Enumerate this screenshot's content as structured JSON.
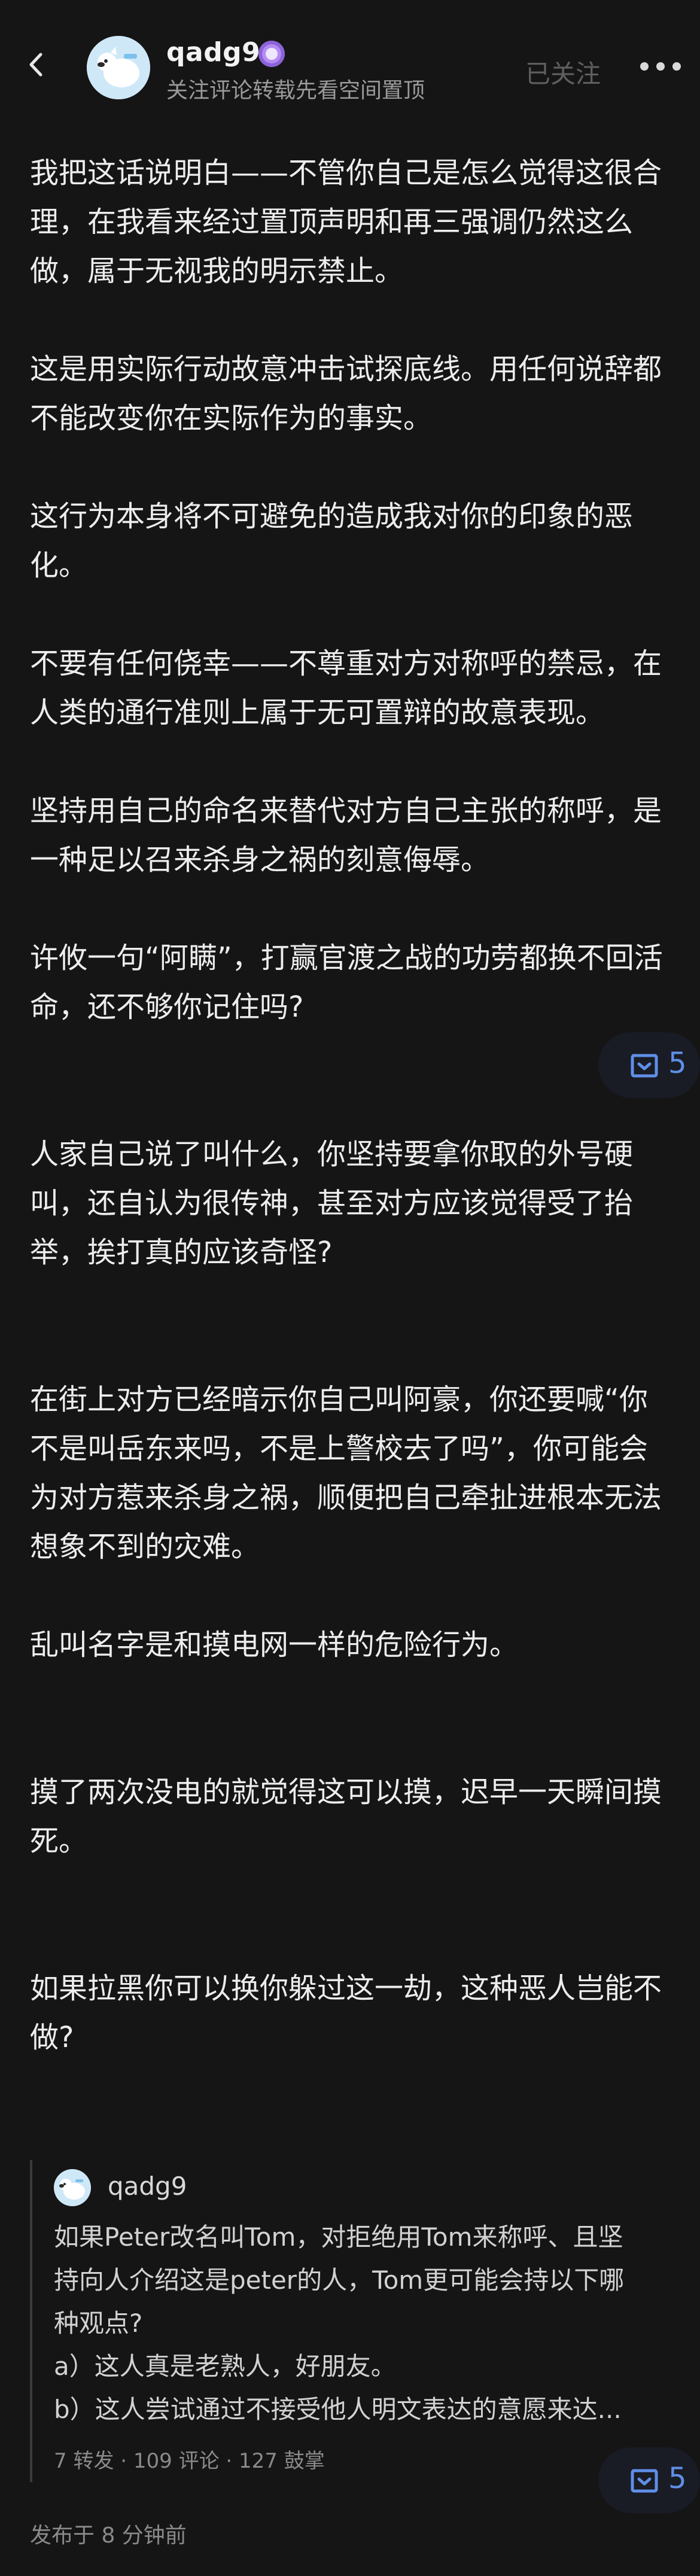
{
  "header": {
    "username": "qadg9",
    "subtitle": "关注评论转载先看空间置顶",
    "follow_status": "已关注",
    "icons": {
      "back": "back-arrow-icon",
      "badge": "verified-badge-icon",
      "more": "more-options-icon"
    }
  },
  "post": {
    "paragraphs": [
      "我把这话说明白——不管你自己是怎么觉得这很合理，在我看来经过置顶声明和再三强调仍然这么做，属于无视我的明示禁止。",
      "这是用实际行动故意冲击试探底线。用任何说辞都不能改变你在实际作为的事实。",
      "这行为本身将不可避免的造成我对你的印象的恶化。",
      "不要有任何侥幸——不尊重对方对称呼的禁忌，在人类的通行准则上属于无可置辩的故意表现。",
      "坚持用自己的命名来替代对方自己主张的称呼，是一种足以召来杀身之祸的刻意侮辱。",
      "许攸一句“阿瞒”，打赢官渡之战的功劳都换不回活命，还不够你记住吗?",
      "人家自己说了叫什么，你坚持要拿你取的外号硬叫，还自认为很传神，甚至对方应该觉得受了抬举，挨打真的应该奇怪?",
      "在街上对方已经暗示你自己叫阿豪，你还要喊“你不是叫岳东来吗，不是上警校去了吗”，你可能会为对方惹来杀身之祸，顺便把自己牵扯进根本无法想象不到的灾难。",
      "乱叫名字是和摸电网一样的危险行为。",
      "摸了两次没电的就觉得这可以摸，迟早一天瞬间摸死。",
      "如果拉黑你可以换你躲过这一劫，这种恶人岂能不做?"
    ],
    "collect_counts": [
      "5",
      "5"
    ],
    "collect_icon": "collect-box-icon"
  },
  "quote": {
    "username": "qadg9",
    "lines": [
      "如果Peter改名叫Tom，对拒绝用Tom来称呼、且坚",
      "持向人介绍这是peter的人，Tom更可能会持以下哪",
      "种观点?",
      "a）这人真是老熟人，好朋友。",
      "b）这人尝试通过不接受他人明文表达的意愿来达..."
    ],
    "stats": "7 转发 · 109 评论 · 127 鼓掌"
  },
  "footer": {
    "timestamp": "发布于 8 分钟前"
  }
}
